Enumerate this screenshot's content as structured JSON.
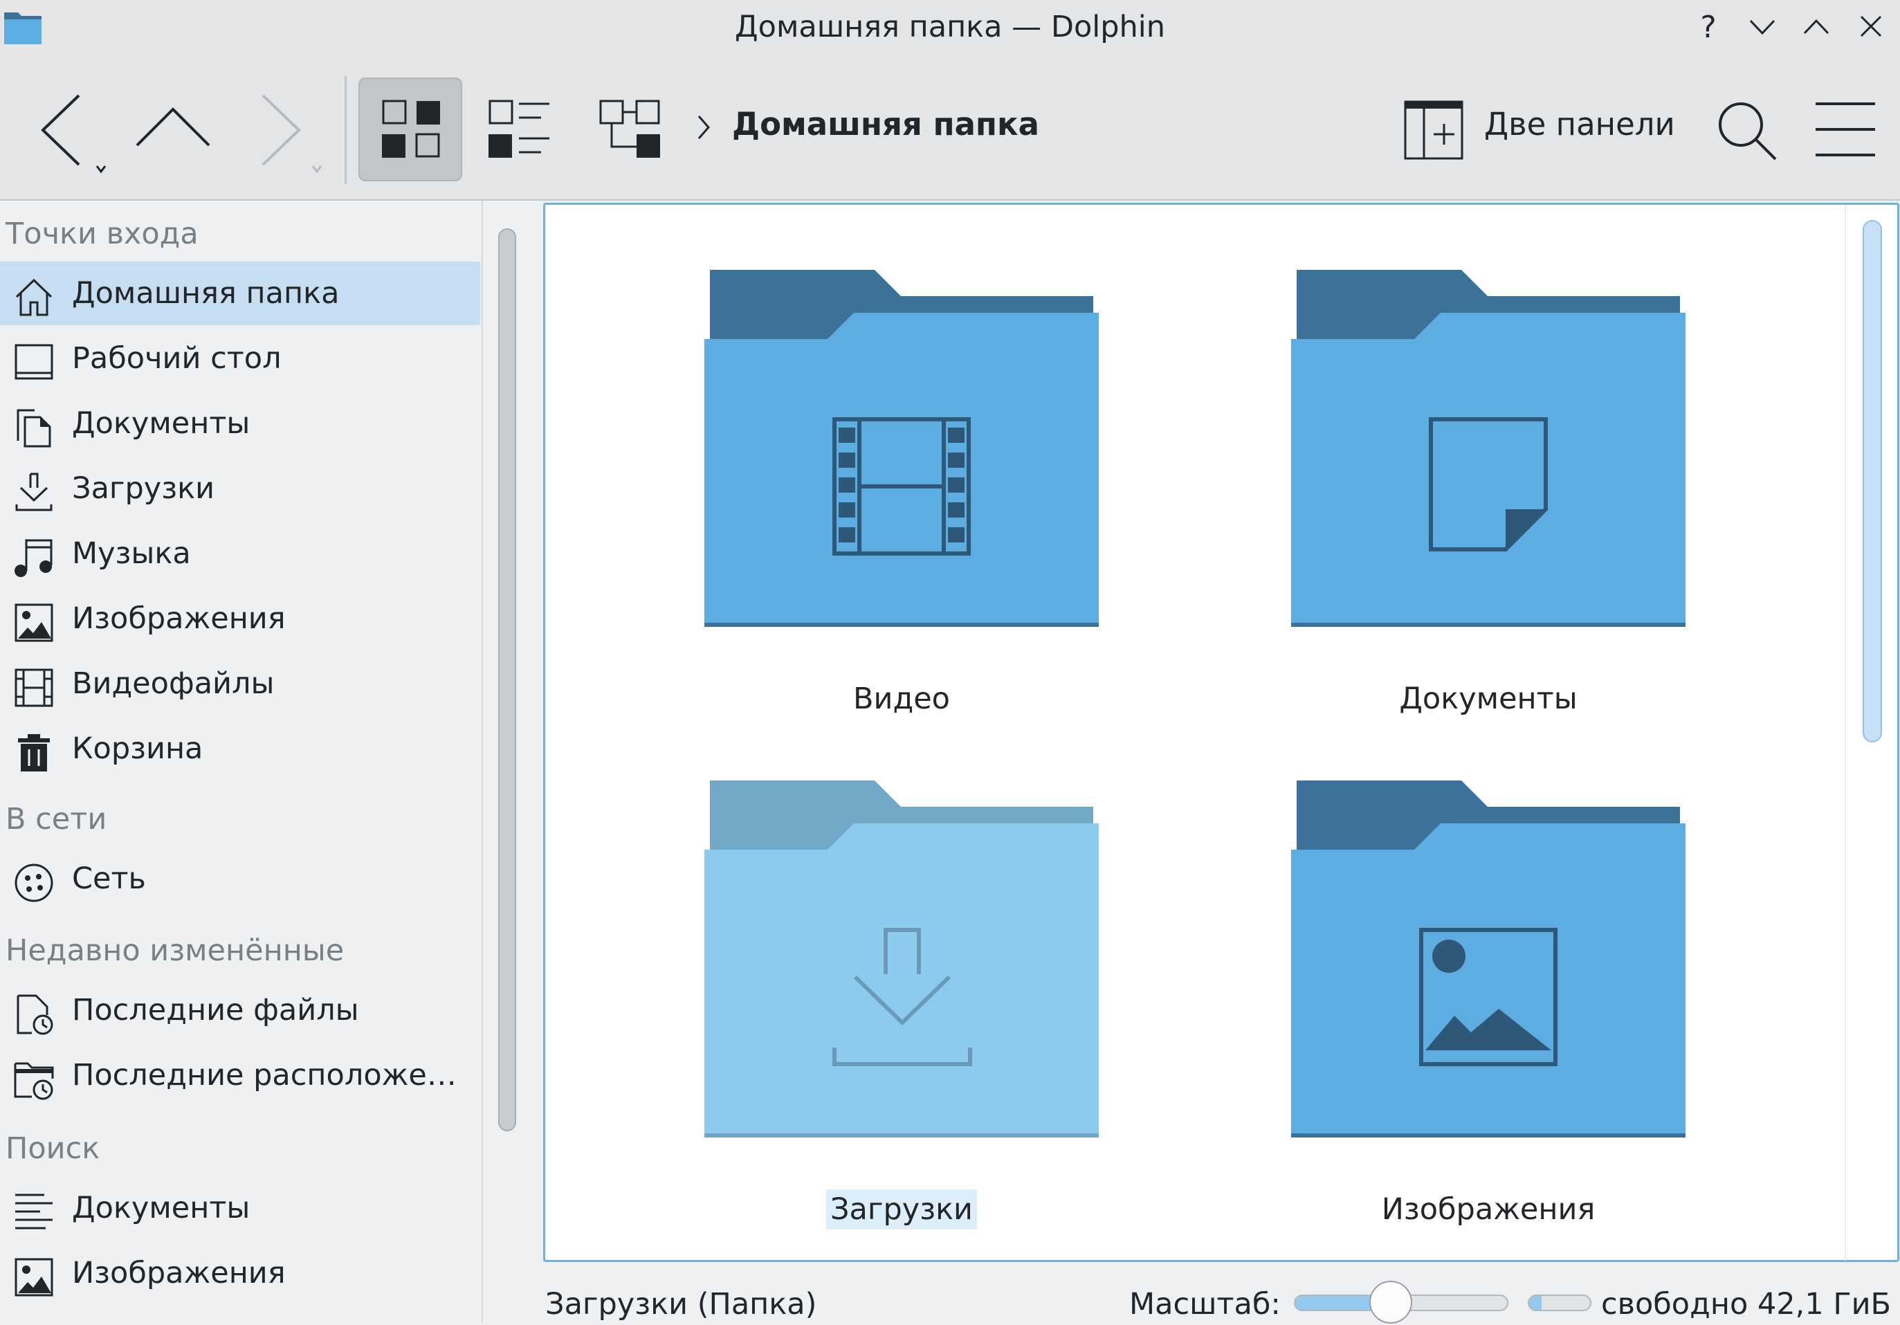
{
  "window": {
    "title": "Домашняя папка — Dolphin",
    "controls": [
      "help-icon",
      "minimize-icon",
      "maximize-icon",
      "close-icon"
    ]
  },
  "toolbar": {
    "breadcrumb": "Домашняя папка",
    "split_label": "Две панели"
  },
  "sidebar": {
    "sections": [
      {
        "title": "Точки входа",
        "items": [
          {
            "label": "Домашняя папка",
            "icon": "home-icon",
            "selected": true
          },
          {
            "label": "Рабочий стол",
            "icon": "desktop-icon"
          },
          {
            "label": "Документы",
            "icon": "documents-icon"
          },
          {
            "label": "Загрузки",
            "icon": "download-icon"
          },
          {
            "label": "Музыка",
            "icon": "music-icon"
          },
          {
            "label": "Изображения",
            "icon": "image-icon"
          },
          {
            "label": "Видеофайлы",
            "icon": "video-icon"
          },
          {
            "label": "Корзина",
            "icon": "trash-icon"
          }
        ]
      },
      {
        "title": "В сети",
        "items": [
          {
            "label": "Сеть",
            "icon": "network-icon"
          }
        ]
      },
      {
        "title": "Недавно изменённые",
        "items": [
          {
            "label": "Последние файлы",
            "icon": "recent-files-icon"
          },
          {
            "label": "Последние расположе…",
            "icon": "recent-locations-icon"
          }
        ]
      },
      {
        "title": "Поиск",
        "items": [
          {
            "label": "Документы",
            "icon": "text-search-icon"
          },
          {
            "label": "Изображения",
            "icon": "image-search-icon"
          }
        ]
      }
    ]
  },
  "files": [
    {
      "name": "Видео",
      "icon": "video-folder-icon",
      "selected": false
    },
    {
      "name": "Документы",
      "icon": "documents-folder-icon",
      "selected": false
    },
    {
      "name": "Загрузки",
      "icon": "downloads-folder-icon",
      "selected": true
    },
    {
      "name": "Изображения",
      "icon": "pictures-folder-icon",
      "selected": false
    }
  ],
  "statusbar": {
    "selection": "Загрузки (Папка)",
    "zoom_label": "Масштаб:",
    "zoom_level": 0.45,
    "free_space": "свободно 42,1 ГиБ",
    "disk_used": 0.2
  },
  "colors": {
    "accent": "#3daee9",
    "folder_body": "#5dade2",
    "folder_tab": "#3d7298",
    "folder_body_selected": "#8dcbee",
    "folder_tab_selected": "#71a8c5",
    "selection_bg": "#c7ddf2"
  }
}
